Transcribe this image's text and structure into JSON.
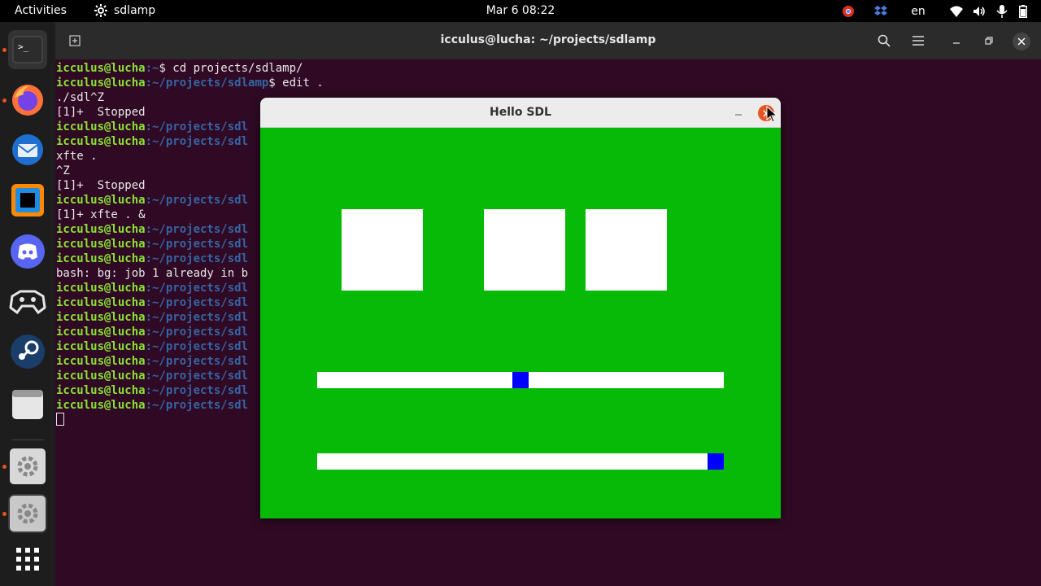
{
  "topbar": {
    "activities": "Activities",
    "app_name": "sdlamp",
    "clock": "Mar 6  08:22",
    "language": "en"
  },
  "dock": {
    "items": [
      {
        "name": "terminal",
        "running": true
      },
      {
        "name": "firefox",
        "running": true
      },
      {
        "name": "thunderbird",
        "running": false
      },
      {
        "name": "toolbox",
        "running": false
      },
      {
        "name": "discord",
        "running": false
      },
      {
        "name": "retroarch",
        "running": false
      },
      {
        "name": "steam",
        "running": false
      },
      {
        "name": "files",
        "running": false
      },
      {
        "name": "gear-app",
        "running": true
      },
      {
        "name": "gear-app-2",
        "running": true
      },
      {
        "name": "show-apps",
        "running": false
      }
    ]
  },
  "terminal": {
    "title": "icculus@lucha: ~/projects/sdlamp",
    "user_host": "icculus@lucha",
    "lines": [
      {
        "user": "icculus@lucha",
        "path": ":~",
        "rest": "$ cd projects/sdlamp/"
      },
      {
        "user": "icculus@lucha",
        "path": ":~/projects/sdlamp",
        "rest": "$ edit ."
      },
      {
        "text": "./sdl^Z"
      },
      {
        "text": "[1]+  Stopped"
      },
      {
        "user": "icculus@lucha",
        "path": ":~/projects/sdl",
        "rest": ""
      },
      {
        "user": "icculus@lucha",
        "path": ":~/projects/sdl",
        "rest": ""
      },
      {
        "text": "xfte ."
      },
      {
        "text": "^Z"
      },
      {
        "text": "[1]+  Stopped"
      },
      {
        "user": "icculus@lucha",
        "path": ":~/projects/sdl",
        "rest": ""
      },
      {
        "text": "[1]+ xfte . &"
      },
      {
        "user": "icculus@lucha",
        "path": ":~/projects/sdl",
        "rest": ""
      },
      {
        "user": "icculus@lucha",
        "path": ":~/projects/sdl",
        "rest": ""
      },
      {
        "user": "icculus@lucha",
        "path": ":~/projects/sdl",
        "rest": ""
      },
      {
        "text": "bash: bg: job 1 already in b"
      },
      {
        "user": "icculus@lucha",
        "path": ":~/projects/sdl",
        "rest": ""
      },
      {
        "user": "icculus@lucha",
        "path": ":~/projects/sdl",
        "rest": ""
      },
      {
        "user": "icculus@lucha",
        "path": ":~/projects/sdl",
        "rest": ""
      },
      {
        "user": "icculus@lucha",
        "path": ":~/projects/sdl",
        "rest": ""
      },
      {
        "user": "icculus@lucha",
        "path": ":~/projects/sdl",
        "rest": ""
      },
      {
        "user": "icculus@lucha",
        "path": ":~/projects/sdl",
        "rest": ""
      },
      {
        "user": "icculus@lucha",
        "path": ":~/projects/sdl",
        "rest": ""
      },
      {
        "user": "icculus@lucha",
        "path": ":~/projects/sdl",
        "rest": ""
      },
      {
        "user": "icculus@lucha",
        "path": ":~/projects/sdl",
        "rest": ""
      }
    ]
  },
  "sdl_window": {
    "title": "Hello SDL",
    "background": "#07ba07",
    "lamps": [
      "lamp-1",
      "lamp-2",
      "lamp-3"
    ],
    "sliders": [
      {
        "name": "slider-1",
        "value": 0.5
      },
      {
        "name": "slider-2",
        "value": 1.0
      }
    ],
    "thumb_color": "#0000ff"
  },
  "colors": {
    "accent": "#e95420",
    "terminal_bg": "#300a24",
    "prompt_user": "#8ae234",
    "prompt_path": "#3465a4"
  }
}
